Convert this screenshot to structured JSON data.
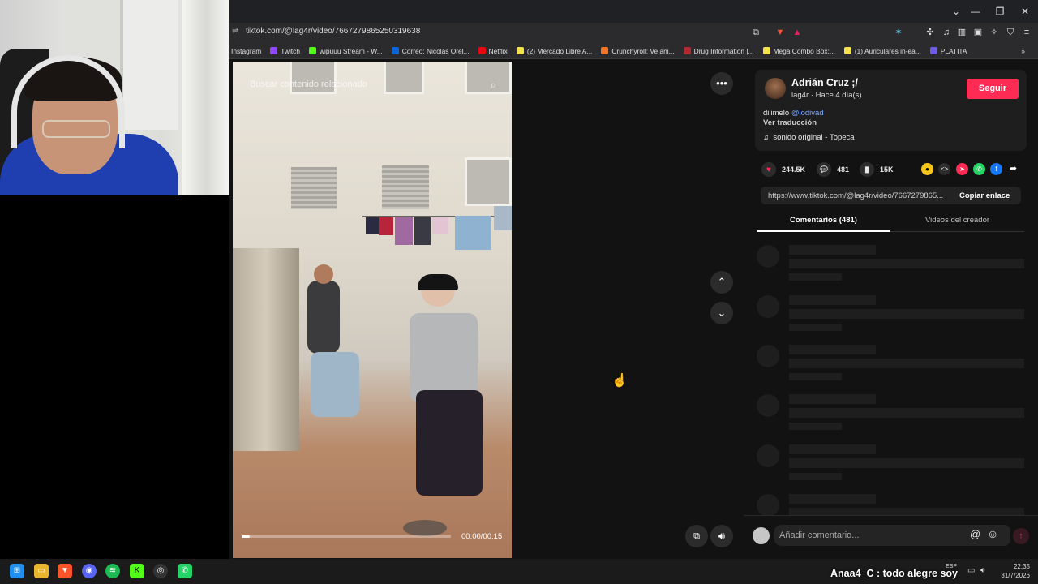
{
  "browser": {
    "url": "tiktok.com/@lag4r/video/7667279865250319638",
    "bookmarks": [
      {
        "label": "Instagram",
        "color": ""
      },
      {
        "label": "Twitch",
        "color": "#9146ff"
      },
      {
        "label": "wipuuu Stream - W...",
        "color": "#53fc18"
      },
      {
        "label": "Correo: Nicolás Orel...",
        "color": "#0a64d6"
      },
      {
        "label": "Netflix",
        "color": "#e50914"
      },
      {
        "label": "(2) Mercado Libre A...",
        "color": "#f4e04d"
      },
      {
        "label": "Crunchyroll: Ve ani...",
        "color": "#f47521"
      },
      {
        "label": "Drug Information |...",
        "color": "#b0272f"
      },
      {
        "label": "Mega Combo Box:...",
        "color": "#f4e04d"
      },
      {
        "label": "(1) Auriculares in-ea...",
        "color": "#f4e04d"
      },
      {
        "label": "PLATITA",
        "color": "#6c5ce7"
      }
    ]
  },
  "video": {
    "search_placeholder": "Buscar contenido relacionado",
    "time": "00:00/00:15",
    "progress_fraction": 0.04
  },
  "author": {
    "name": "Adrián Cruz ;/",
    "meta": "lag4r · Hace 4 día(s)",
    "follow_label": "Seguir"
  },
  "description": {
    "text": "diiimelo ",
    "mention": "@lodivad",
    "translate": "Ver traducción",
    "sound": "sonido original - Topeca"
  },
  "stats": {
    "likes": "244.5K",
    "comments": "481",
    "saves": "15K"
  },
  "share": {
    "link": "https://www.tiktok.com/@lag4r/video/7667279865...",
    "copy_label": "Copiar enlace"
  },
  "tabs": {
    "comments": "Comentarios (481)",
    "creator_videos": "Videos del creador"
  },
  "comment_box": {
    "placeholder": "Añadir comentario..."
  },
  "taskbar": {
    "overlay_text": "Anaa4_C : todo alegre soy",
    "lang": "ESP",
    "time": "22:35",
    "date": "31/7/2026"
  },
  "colors": {
    "accent": "#fe2c55",
    "mention": "#7aa7ff"
  }
}
